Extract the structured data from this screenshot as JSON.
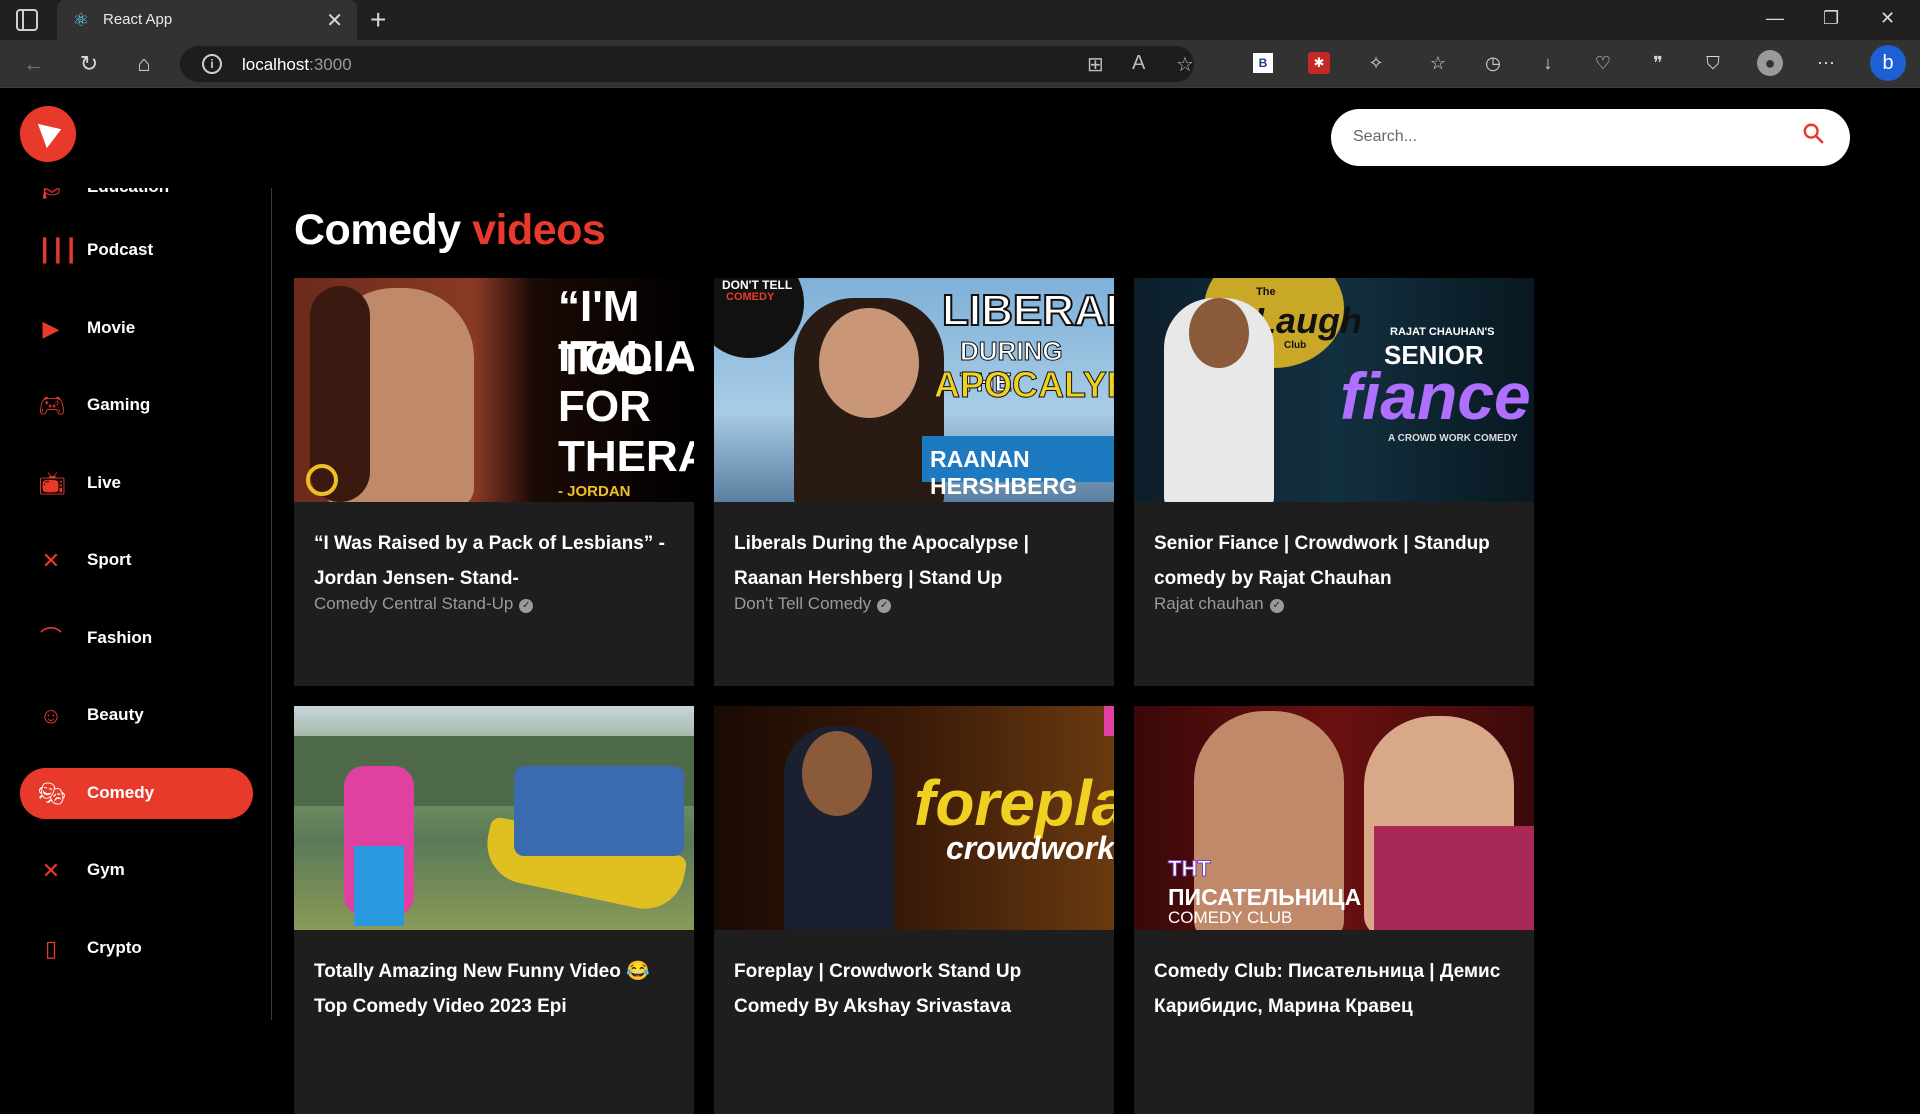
{
  "browser": {
    "tab_title": "React App",
    "url_host": "localhost",
    "url_port": ":3000"
  },
  "search": {
    "placeholder": "Search..."
  },
  "categories": [
    {
      "label": "Education",
      "icon": "school-icon"
    },
    {
      "label": "Podcast",
      "icon": "graphic-eq-icon"
    },
    {
      "label": "Movie",
      "icon": "ondemand-video-icon"
    },
    {
      "label": "Gaming",
      "icon": "sports-esports-icon"
    },
    {
      "label": "Live",
      "icon": "live-tv-icon"
    },
    {
      "label": "Sport",
      "icon": "fitness-center-icon"
    },
    {
      "label": "Fashion",
      "icon": "checkroom-icon"
    },
    {
      "label": "Beauty",
      "icon": "face-retouching-icon"
    },
    {
      "label": "Comedy",
      "icon": "theater-comedy-icon",
      "active": true
    },
    {
      "label": "Gym",
      "icon": "fitness-center-icon"
    },
    {
      "label": "Crypto",
      "icon": "developer-mode-icon"
    }
  ],
  "heading": {
    "category": "Comedy",
    "suffix": "videos"
  },
  "videos": [
    {
      "title": "“I Was Raised by a Pack of Lesbians” - Jordan Jensen- Stand-",
      "channel": "Comedy Central Stand-Up",
      "thumb_text": [
        "“I'M TOO",
        "ITALIAN",
        "FOR",
        "THERAPY",
        "- JORDAN JENSEN"
      ]
    },
    {
      "title": "Liberals During the Apocalypse | Raanan Hershberg | Stand Up",
      "channel": "Don't Tell Comedy",
      "thumb_text": [
        "DON'T TELL",
        "COMEDY",
        "LIBERALS",
        "DURING THE",
        "APOCALYPSE",
        "RAANAN HERSHBERG"
      ]
    },
    {
      "title": "Senior Fiance | Crowdwork | Standup comedy by Rajat Chauhan",
      "channel": "Rajat chauhan",
      "thumb_text": [
        "The",
        "Laugh",
        "Club",
        "RAJAT CHAUHAN'S",
        "SENIOR",
        "fiance",
        "A CROWD WORK COMEDY"
      ]
    },
    {
      "title": "Totally Amazing New Funny Video 😂 Top Comedy Video 2023 Epi",
      "channel": "",
      "thumb_text": []
    },
    {
      "title": "Foreplay | Crowdwork Stand Up Comedy By Akshay Srivastava",
      "channel": "",
      "thumb_text": [
        "foreplay",
        "crowdwork"
      ]
    },
    {
      "title": "Comedy Club: Писательница | Демис Карибидис, Марина Кравец",
      "channel": "",
      "thumb_text": [
        "ТНТ",
        "ПИСАТЕЛЬНИЦА",
        "COMEDY CLUB"
      ]
    }
  ],
  "colors": {
    "accent": "#e83a2a",
    "card_bg": "#1e1e1e",
    "page_bg": "#000000"
  }
}
